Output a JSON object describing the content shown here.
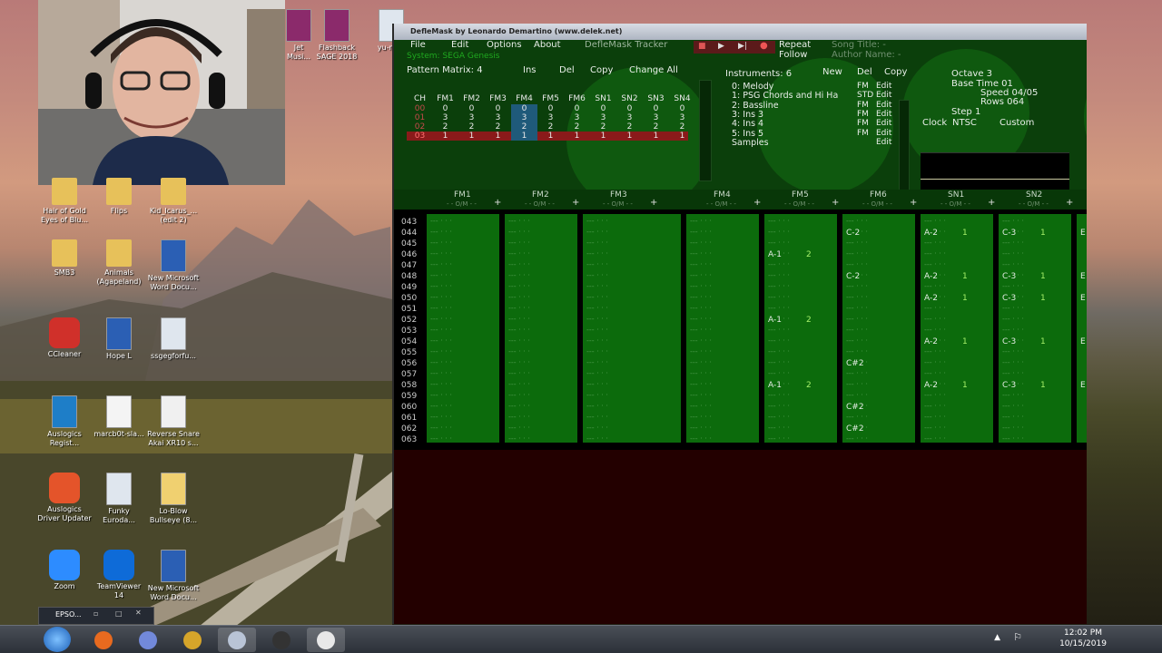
{
  "desktop_icons": [
    {
      "id": "jet",
      "label": "Jet\nMusi...",
      "icon": "winrar-icon"
    },
    {
      "id": "flashback",
      "label": "Flashback\nSAGE 2018",
      "icon": "winrar-icon"
    },
    {
      "id": "yuno",
      "label": "yu-no...",
      "icon": "file-icon"
    },
    {
      "id": "hair",
      "label": "Hair of Gold\nEyes of Blu...",
      "icon": "folder-icon"
    },
    {
      "id": "flips",
      "label": "Flips",
      "icon": "folder-icon"
    },
    {
      "id": "kid",
      "label": "Kid_Icarus_...\n(edit 2)",
      "icon": "folder-icon"
    },
    {
      "id": "smb3",
      "label": "SMB3",
      "icon": "folder-icon"
    },
    {
      "id": "animals",
      "label": "Animals\n(Agapeland)",
      "icon": "folder-icon"
    },
    {
      "id": "newword1",
      "label": "New Microsoft\nWord Docu...",
      "icon": "word-icon"
    },
    {
      "id": "ccleaner",
      "label": "CCleaner",
      "icon": "ccleaner-icon"
    },
    {
      "id": "hopel",
      "label": "Hope L",
      "icon": "word-icon"
    },
    {
      "id": "ssgeg",
      "label": "ssgegforfu...",
      "icon": "file-icon"
    },
    {
      "id": "auslogics",
      "label": "Auslogics\nRegist...",
      "icon": "auslogics-icon"
    },
    {
      "id": "march",
      "label": "marcb0t-sla...",
      "icon": "blank-file-icon"
    },
    {
      "id": "reverse",
      "label": "Reverse Snare\nAkai XR10 s...",
      "icon": "wav-icon"
    },
    {
      "id": "driver",
      "label": "Auslogics\nDriver Updater",
      "icon": "driver-updater-icon"
    },
    {
      "id": "funky",
      "label": "Funky\nEuroda...",
      "icon": "file-icon"
    },
    {
      "id": "loblow",
      "label": "Lo-Blow\nBullseye (8...",
      "icon": "file-edit-icon"
    },
    {
      "id": "zoom",
      "label": "Zoom",
      "icon": "zoom-icon"
    },
    {
      "id": "teamviewer",
      "label": "TeamViewer\n14",
      "icon": "teamviewer-icon"
    },
    {
      "id": "newword2",
      "label": "New Microsoft\nWord Docu...",
      "icon": "word-icon"
    }
  ],
  "taskbar": {
    "mini_label": "EPSO...",
    "time": "12:02 PM",
    "date": "10/15/2019",
    "buttons": [
      "start-orb-icon",
      "firefox-icon",
      "discord-icon",
      "r-app-icon",
      "deflemask-icon",
      "obs-icon",
      "skull-app-icon"
    ]
  },
  "window": {
    "title": "DefleMask by Leonardo Demartino (www.delek.net)",
    "menu": [
      "File",
      "Edit",
      "Options",
      "About"
    ],
    "app_name": "DefleMask Tracker",
    "system_label": "System: SEGA Genesis",
    "repeat_label": "Repeat",
    "follow_label": "Follow",
    "song_title_label": "Song Title: -",
    "author_label": "Author Name: -",
    "pattern_matrix_label": "Pattern Matrix: 4",
    "matrix_buttons": [
      "Ins",
      "Del",
      "Copy",
      "Change All"
    ],
    "matrix_channels": [
      "CH",
      "FM1",
      "FM2",
      "FM3",
      "FM4",
      "FM5",
      "FM6",
      "SN1",
      "SN2",
      "SN3",
      "SN4"
    ],
    "matrix_rows": [
      {
        "row": "00",
        "values": [
          "0",
          "0",
          "0",
          "0",
          "0",
          "0",
          "0",
          "0",
          "0",
          "0"
        ]
      },
      {
        "row": "01",
        "values": [
          "3",
          "3",
          "3",
          "3",
          "3",
          "3",
          "3",
          "3",
          "3",
          "3"
        ]
      },
      {
        "row": "02",
        "values": [
          "2",
          "2",
          "2",
          "2",
          "2",
          "2",
          "2",
          "2",
          "2",
          "2"
        ]
      },
      {
        "row": "03",
        "values": [
          "1",
          "1",
          "1",
          "1",
          "1",
          "1",
          "1",
          "1",
          "1",
          "1"
        ]
      }
    ],
    "instruments_label": "Instruments: 6",
    "instrument_buttons": [
      "New",
      "Del",
      "Copy"
    ],
    "instruments": [
      {
        "name": "0: Melody",
        "type": "FM",
        "edit": "Edit"
      },
      {
        "name": "1: PSG Chords and Hi Ha",
        "type": "STD",
        "edit": "Edit"
      },
      {
        "name": "2: Bassline",
        "type": "FM",
        "edit": "Edit"
      },
      {
        "name": "3: Ins 3",
        "type": "FM",
        "edit": "Edit"
      },
      {
        "name": "4: Ins 4",
        "type": "FM",
        "edit": "Edit"
      },
      {
        "name": "5: Ins 5",
        "type": "FM",
        "edit": "Edit"
      },
      {
        "name": "Samples",
        "type": "",
        "edit": "Edit"
      }
    ],
    "settings": {
      "octave": "Octave 3",
      "base_time": "Base Time 01",
      "speed": "Speed 04/05",
      "rows": "Rows 064",
      "step": "Step 1",
      "clock": "Clock",
      "clock_value": "NTSC",
      "custom": "Custom"
    },
    "channel_headers": [
      "FM1",
      "FM2",
      "FM3",
      "FM4",
      "FM5",
      "FM6",
      "SN1",
      "SN2"
    ],
    "channel_sub": "- - O/M - -",
    "row_numbers": [
      "043",
      "044",
      "045",
      "046",
      "047",
      "048",
      "049",
      "050",
      "051",
      "052",
      "053",
      "054",
      "055",
      "056",
      "057",
      "058",
      "059",
      "060",
      "061",
      "062",
      "063"
    ],
    "notes": [
      {
        "row": "044",
        "fm6": "C-2",
        "sn1": "A-2",
        "sn1v": "1",
        "sn2": "C-3",
        "sn2v": "1",
        "x": "E"
      },
      {
        "row": "046",
        "fm5": "A-1",
        "fm5v": "2"
      },
      {
        "row": "048",
        "fm6": "C-2",
        "sn1": "A-2",
        "sn1v": "1",
        "sn2": "C-3",
        "sn2v": "1",
        "x": "E"
      },
      {
        "row": "050",
        "sn1": "A-2",
        "sn1v": "1",
        "sn2": "C-3",
        "sn2v": "1",
        "x": "E"
      },
      {
        "row": "052",
        "fm5": "A-1",
        "fm5v": "2"
      },
      {
        "row": "054",
        "sn1": "A-2",
        "sn1v": "1",
        "sn2": "C-3",
        "sn2v": "1",
        "x": "E"
      },
      {
        "row": "056",
        "fm6": "C#2"
      },
      {
        "row": "058",
        "fm5": "A-1",
        "fm5v": "2",
        "sn1": "A-2",
        "sn1v": "1",
        "sn2": "C-3",
        "sn2v": "1",
        "x": "E"
      },
      {
        "row": "060",
        "fm6": "C#2"
      },
      {
        "row": "062",
        "fm6": "C#2"
      }
    ]
  }
}
